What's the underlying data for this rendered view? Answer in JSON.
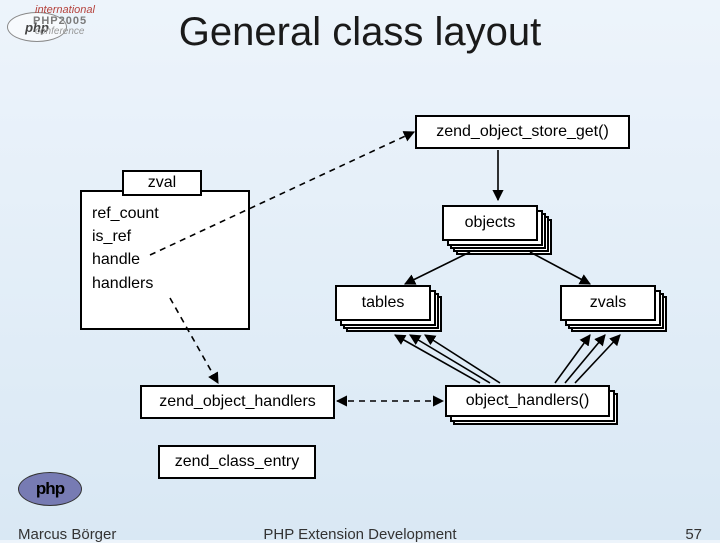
{
  "title": "General class layout",
  "boxes": {
    "zend_object_store_get": "zend_object_store_get()",
    "zval_title": "zval",
    "zval_fields": [
      "ref_count",
      "is_ref",
      "handle",
      "handlers"
    ],
    "objects_label": "objects",
    "tables_label": "tables",
    "zvals_label": "zvals",
    "zend_object_handlers": "zend_object_handlers",
    "object_handlers_call": "object_handlers()",
    "zend_class_entry": "zend_class_entry"
  },
  "footer": {
    "author": "Marcus Börger",
    "center": "PHP Extension Development",
    "page": "57"
  },
  "logos": {
    "top_php": "php",
    "top_line1": "international",
    "top_line2": "PHP2005",
    "top_line3": "conference",
    "bottom": "php"
  }
}
